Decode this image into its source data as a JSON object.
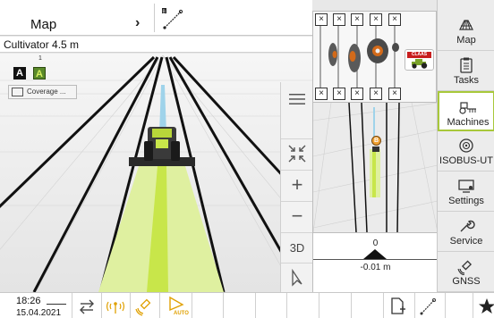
{
  "topbar": {
    "title": "Map",
    "chevron": "›",
    "ab_icon": "ab-line-icon"
  },
  "implement": {
    "name": "Cultivator 4.5 m",
    "lane_number": "1",
    "box_a": "A",
    "box_a_active": "A",
    "coverage_label": "Coverage ..."
  },
  "view_buttons": {
    "menu": "hamburger-icon",
    "collapse": "collapse-arrows-icon",
    "zoom_in": "+",
    "zoom_out": "−",
    "view_mode": "3D",
    "locate": "navigation-pointer-icon"
  },
  "camera_panel": {
    "close_marks": [
      "×",
      "×",
      "×",
      "×",
      "×",
      "×",
      "×",
      "×",
      "×",
      "×"
    ],
    "brand": "CLAAS"
  },
  "minimap": {
    "marker_label": "B"
  },
  "lightbar": {
    "offset_index": "0",
    "deviation": "-0.01 m"
  },
  "nav": {
    "items": [
      {
        "label": "Map",
        "icon": "map-icon"
      },
      {
        "label": "Tasks",
        "icon": "clipboard-icon"
      },
      {
        "label": "Machines",
        "icon": "tractor-implement-icon",
        "active": true
      },
      {
        "label": "ISOBUS-UT",
        "icon": "isobus-icon"
      },
      {
        "label": "Settings",
        "icon": "monitor-settings-icon"
      },
      {
        "label": "Service",
        "icon": "wrench-icon"
      },
      {
        "label": "GNSS",
        "icon": "satellite-icon"
      }
    ]
  },
  "statusbar": {
    "time": "18:26",
    "date": "15.04.2021",
    "icons": [
      "swap-arrows-icon",
      "rtk-signal-icon",
      "satellite-steer-icon",
      "auto-steer-icon"
    ],
    "auto_label": "AUTO",
    "right_icons": [
      "add-document-icon",
      "ab-line-icon",
      "favorite-star-icon"
    ]
  },
  "colors": {
    "accent": "#a8c83a",
    "guidance_green": "#c8e64a",
    "coverage_green": "#dff0a0",
    "guide_blue": "#9fd3ea",
    "brand_red": "#c81e1e"
  }
}
